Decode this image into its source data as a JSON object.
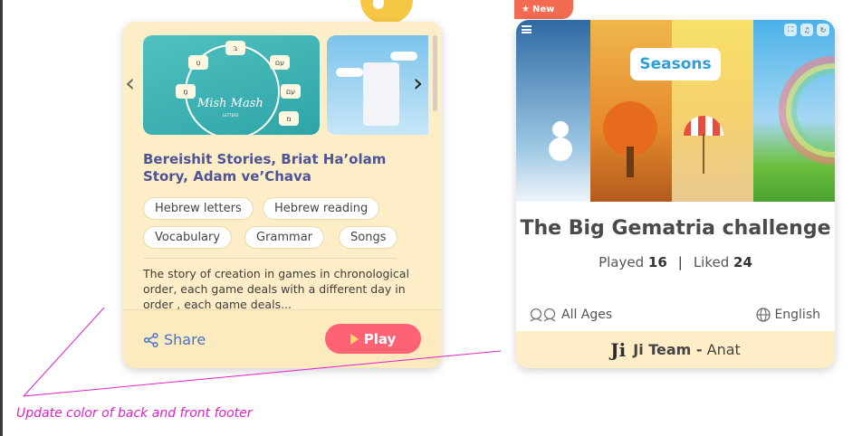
{
  "card_a": {
    "title": "Bereishit Stories, Briat Ha’olam Story, Adam ve’Chava",
    "thumb1": {
      "title": "Mish Mash",
      "subtitle": "LETTERS",
      "chips": [
        "בּ",
        "טְ",
        "עם",
        "מֶ",
        "עם",
        "מ"
      ]
    },
    "tags": [
      "Hebrew letters",
      "Hebrew reading",
      "Vocabulary",
      "Grammar",
      "Songs"
    ],
    "description": "The story of creation in games in chronological order, each game deals with a different day in order , each game deals...",
    "share_label": "Share",
    "play_label": "Play",
    "icons": {
      "prev": "chevron-left-icon",
      "next": "chevron-right-icon",
      "share": "share-icon",
      "play": "play-icon"
    }
  },
  "card_b": {
    "badge": "New",
    "cover_logo": "Seasons",
    "title": "The Big Gematria challenge",
    "played_label": "Played",
    "played_value": "16",
    "liked_label": "Liked",
    "liked_value": "24",
    "ages": "All Ages",
    "language": "English",
    "author_team": "Ji Team -",
    "author_name": "Anat",
    "icons": {
      "menu": "menu-icon",
      "expand": "expand-icon",
      "music": "music-icon",
      "refresh": "refresh-icon",
      "ages": "kids-icon",
      "language": "globe-icon",
      "team_logo": "ji-logo-icon"
    }
  },
  "annotation": {
    "note": "Update color of back and front footer",
    "color": "#e020c6"
  },
  "colors": {
    "footer_back": "#fdeabf",
    "footer_front": "#fdeec7",
    "play_button": "#ff6275",
    "title_blue": "#4f5398",
    "link_blue": "#3f74d0",
    "badge": "#f26a4f"
  }
}
